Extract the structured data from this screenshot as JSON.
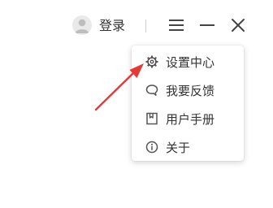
{
  "header": {
    "login_label": "登录",
    "icons": {
      "avatar": "user-avatar-icon",
      "menu": "hamburger-menu-icon",
      "minimize": "minimize-icon",
      "close": "close-icon"
    }
  },
  "menu": {
    "items": [
      {
        "label": "设置中心",
        "icon": "gear-icon"
      },
      {
        "label": "我要反馈",
        "icon": "speech-bubble-icon"
      },
      {
        "label": "用户手册",
        "icon": "manual-icon"
      },
      {
        "label": "关于",
        "icon": "info-icon"
      }
    ]
  },
  "annotation": {
    "arrow_color": "#e53935",
    "points_to": "设置中心"
  }
}
